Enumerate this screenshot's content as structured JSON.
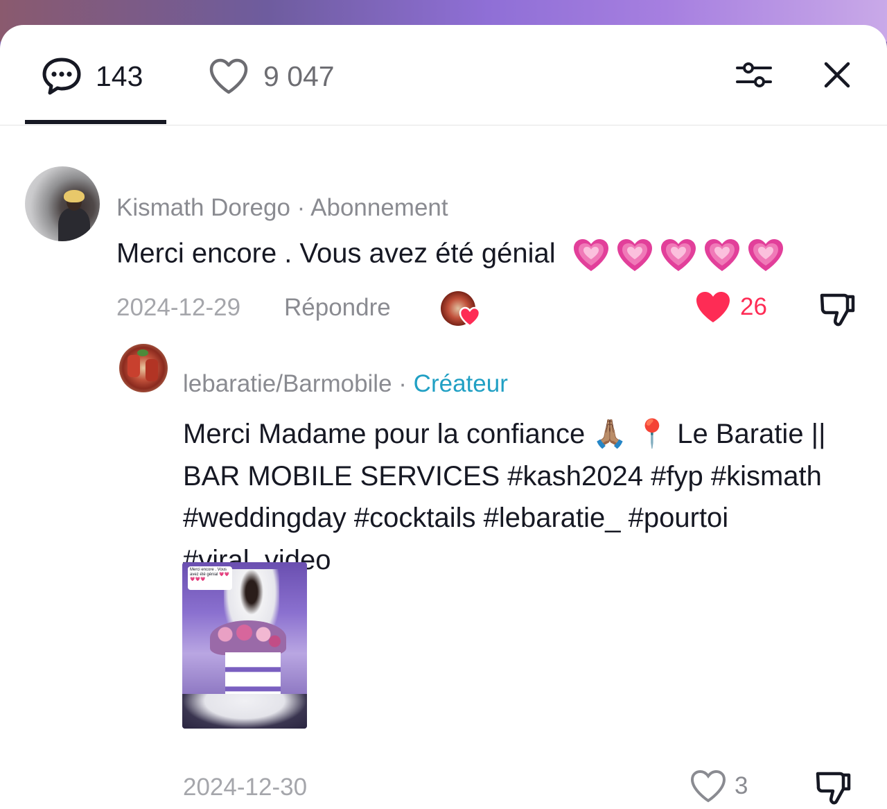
{
  "tabs": {
    "comments_count": "143",
    "likes_count": "9 047"
  },
  "comments": [
    {
      "username": "Kismath Dorego",
      "separator": " · ",
      "role": "Abonnement",
      "text": "Merci encore . Vous avez été génial",
      "emoji_count": 5,
      "emoji_icon": "growing-heart",
      "date": "2024-12-29",
      "reply_label": "Répondre",
      "likes": "26",
      "liked": true,
      "liked_by_creator": true
    },
    {
      "username": "lebaratie/Barmobile",
      "separator": " · ",
      "role": "Créateur",
      "text": " Merci Madame pour la confiance 🙏🏽   📍 Le Baratie || BAR MOBILE SERVICES #kash2024 #fyp #kismath #weddingday #cocktails #lebaratie_ #pourtoi #viral_video",
      "video_caption": "Merci encore . Vous avez été génial 💗💗💗💗💗",
      "date": "2024-12-30",
      "likes": "3",
      "liked": false
    }
  ],
  "colors": {
    "like_active": "#fe2c55",
    "creator_role": "#21a0c4",
    "text_primary": "#161823",
    "text_muted": "#8a8b91"
  },
  "icons": {
    "comments_tab": "speech-bubble-icon",
    "likes_tab": "heart-outline-icon",
    "filter": "sliders-icon",
    "close": "close-icon",
    "dislike": "thumbs-down-icon"
  }
}
